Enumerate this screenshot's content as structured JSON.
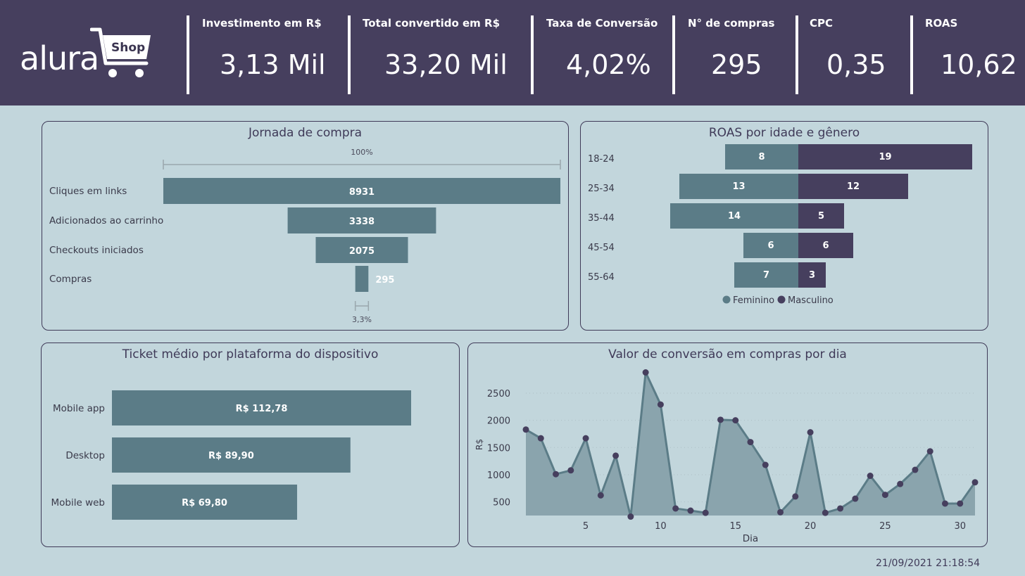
{
  "header": {
    "logo_text": "alura",
    "logo_badge": "Shop",
    "kpis": [
      {
        "label": "Investimento em R$",
        "value": "3,13 Mil"
      },
      {
        "label": "Total convertido em R$",
        "value": "33,20 Mil"
      },
      {
        "label": "Taxa de Conversão",
        "value": "4,02%"
      },
      {
        "label": "N° de compras",
        "value": "295"
      },
      {
        "label": "CPC",
        "value": "0,35"
      },
      {
        "label": "ROAS",
        "value": "10,62"
      }
    ]
  },
  "colors": {
    "header_bg": "#463f5e",
    "page_bg": "#c2d6dc",
    "teal": "#5b7c87",
    "purple": "#463f5e",
    "area_fill": "#8aa4ad"
  },
  "timestamp": "21/09/2021 21:18:54",
  "chart_data": [
    {
      "type": "funnel",
      "title": "Jornada de compra",
      "categories": [
        "Cliques em links",
        "Adicionados ao carrinho",
        "Checkouts iniciados",
        "Compras"
      ],
      "values": [
        8931,
        3338,
        2075,
        295
      ],
      "top_percent_label": "100%",
      "bottom_percent_label": "3,3%"
    },
    {
      "type": "bar",
      "orientation": "diverging-horizontal",
      "title": "ROAS por idade e gênero",
      "categories": [
        "18-24",
        "25-34",
        "35-44",
        "45-54",
        "55-64"
      ],
      "series": [
        {
          "name": "Feminino",
          "values": [
            8,
            13,
            14,
            6,
            7
          ],
          "color": "#5b7c87"
        },
        {
          "name": "Masculino",
          "values": [
            19,
            12,
            5,
            6,
            3
          ],
          "color": "#463f5e"
        }
      ],
      "legend": "bottom"
    },
    {
      "type": "bar",
      "orientation": "horizontal",
      "title": "Ticket médio por plataforma do dispositivo",
      "categories": [
        "Mobile app",
        "Desktop",
        "Mobile web"
      ],
      "values": [
        112.78,
        89.9,
        69.8
      ],
      "labels": [
        "R$ 112,78",
        "R$ 89,90",
        "R$ 69,80"
      ]
    },
    {
      "type": "area",
      "title": "Valor de conversão em compras por dia",
      "xlabel": "Dia",
      "ylabel": "R$",
      "x": [
        1,
        2,
        3,
        4,
        5,
        6,
        7,
        8,
        9,
        10,
        11,
        12,
        13,
        14,
        15,
        16,
        17,
        18,
        19,
        20,
        21,
        22,
        23,
        24,
        25,
        26,
        27,
        28,
        29,
        30,
        31
      ],
      "y": [
        1830,
        1670,
        1010,
        1080,
        1670,
        620,
        1350,
        230,
        2880,
        2290,
        380,
        340,
        300,
        2010,
        2000,
        1600,
        1180,
        310,
        600,
        1780,
        300,
        380,
        560,
        980,
        630,
        830,
        1090,
        1430,
        470,
        470,
        860
      ],
      "xticks": [
        5,
        10,
        15,
        20,
        25,
        30
      ],
      "yticks": [
        500,
        1000,
        1500,
        2000,
        2500
      ],
      "xlim": [
        1,
        31
      ],
      "ylim": [
        250,
        2900
      ]
    }
  ]
}
